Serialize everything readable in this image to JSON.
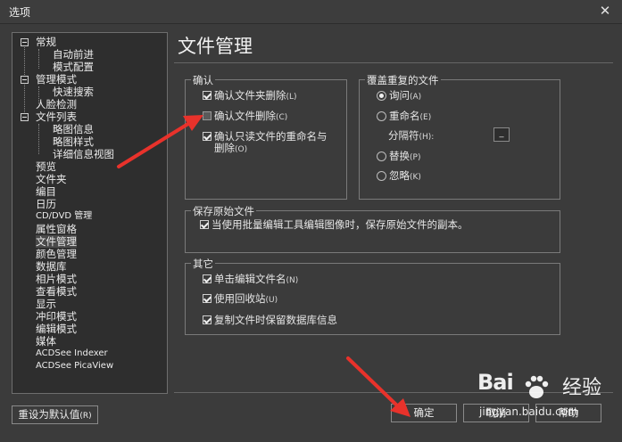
{
  "window": {
    "title": "选项",
    "close_glyph": "✕"
  },
  "tree": {
    "items": [
      {
        "label": "常规",
        "name": "tree-item-general"
      },
      {
        "label": "自动前进",
        "name": "tree-item-auto-advance"
      },
      {
        "label": "模式配置",
        "name": "tree-item-mode-config"
      },
      {
        "label": "管理模式",
        "name": "tree-item-manage-mode"
      },
      {
        "label": "快速搜索",
        "name": "tree-item-quick-search"
      },
      {
        "label": "人脸检测",
        "name": "tree-item-face-detection"
      },
      {
        "label": "文件列表",
        "name": "tree-item-file-list"
      },
      {
        "label": "略图信息",
        "name": "tree-item-thumbnail-info"
      },
      {
        "label": "略图样式",
        "name": "tree-item-thumbnail-style"
      },
      {
        "label": "详细信息视图",
        "name": "tree-item-details-view"
      },
      {
        "label": "预览",
        "name": "tree-item-preview"
      },
      {
        "label": "文件夹",
        "name": "tree-item-folders"
      },
      {
        "label": "编目",
        "name": "tree-item-catalog"
      },
      {
        "label": "日历",
        "name": "tree-item-calendar"
      },
      {
        "label": "CD/DVD 管理",
        "name": "tree-item-cd-dvd"
      },
      {
        "label": "属性窗格",
        "name": "tree-item-properties"
      },
      {
        "label": "文件管理",
        "name": "tree-item-file-management"
      },
      {
        "label": "颜色管理",
        "name": "tree-item-color-management"
      },
      {
        "label": "数据库",
        "name": "tree-item-database"
      },
      {
        "label": "相片模式",
        "name": "tree-item-photo-mode"
      },
      {
        "label": "查看模式",
        "name": "tree-item-view-mode"
      },
      {
        "label": "显示",
        "name": "tree-item-display"
      },
      {
        "label": "冲印模式",
        "name": "tree-item-print-mode"
      },
      {
        "label": "编辑模式",
        "name": "tree-item-edit-mode"
      },
      {
        "label": "媒体",
        "name": "tree-item-media"
      },
      {
        "label": "ACDSee Indexer",
        "name": "tree-item-indexer"
      },
      {
        "label": "ACDSee PicaView",
        "name": "tree-item-picaview"
      }
    ]
  },
  "panel": {
    "title": "文件管理"
  },
  "confirm": {
    "legend": "确认",
    "options": [
      {
        "label": "确认文件夹删除",
        "key": "(L)",
        "checked": true
      },
      {
        "label": "确认文件删除",
        "key": "(C)",
        "checked": false
      },
      {
        "label": "确认只读文件的重命名与",
        "label2": "删除",
        "key": "(O)",
        "checked": true
      }
    ]
  },
  "overwrite": {
    "legend": "覆盖重复的文件",
    "options": [
      {
        "label": "询问",
        "key": "(A)",
        "selected": true
      },
      {
        "label": "重命名",
        "key": "(E)",
        "selected": false
      },
      {
        "label": "替换",
        "key": "(P)",
        "selected": false
      },
      {
        "label": "忽略",
        "key": "(K)",
        "selected": false
      }
    ],
    "separator_label": "分隔符",
    "separator_key": "(H):",
    "separator_value": "_"
  },
  "save_original": {
    "legend": "保存原始文件",
    "option": {
      "label": "当使用批量编辑工具编辑图像时，保存原始文件的副本。",
      "checked": true
    }
  },
  "other": {
    "legend": "其它",
    "options": [
      {
        "label": "单击编辑文件名",
        "key": "(N)",
        "checked": true
      },
      {
        "label": "使用回收站",
        "key": "(U)",
        "checked": true
      },
      {
        "label": "复制文件时保留数据库信息",
        "key": "",
        "checked": true
      }
    ]
  },
  "buttons": {
    "reset_label": "重设为默认值",
    "reset_key": "(R)",
    "ok_label": "确定",
    "cancel_label": "取消",
    "help_label": "帮助"
  },
  "annotations": {
    "arrow_color": "#e8322b"
  },
  "watermark": {
    "brand": "Bai",
    "brand2": "经验",
    "url": "jingyan.baidu.com"
  }
}
